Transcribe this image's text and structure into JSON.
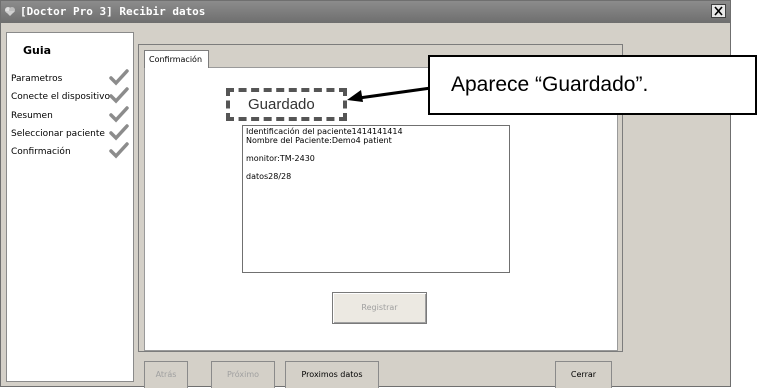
{
  "window": {
    "title": "[Doctor Pro 3] Recibir datos"
  },
  "guide": {
    "title": "Guia",
    "steps": [
      {
        "label": "Parametros",
        "done": true
      },
      {
        "label": "Conecte el dispositivo",
        "done": true
      },
      {
        "label": "Resumen",
        "done": true
      },
      {
        "label": "Seleccionar paciente",
        "done": true
      },
      {
        "label": "Confirmación",
        "done": true
      }
    ]
  },
  "tab": {
    "label": "Confirmación"
  },
  "status": {
    "text": "Guardado"
  },
  "info_lines": [
    "Identificación del paciente1414141414",
    "Nombre del Paciente:Demo4 patient",
    "monitor:TM-2430",
    "datos28/28"
  ],
  "buttons": {
    "register": "Registrar",
    "back": "Atrás",
    "next": "Próximo",
    "next_data": "Proximos datos",
    "close": "Cerrar"
  },
  "callout": {
    "text": "Aparece “Guardado”."
  },
  "colors": {
    "titlebar": "#7a7a7a",
    "window_bg": "#d4d0c8",
    "check": "#8c8c8c",
    "dashed_border": "#555555"
  }
}
